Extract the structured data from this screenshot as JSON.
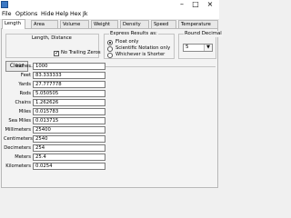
{
  "window": {
    "title": ""
  },
  "menu": [
    "File",
    "Options",
    "Hide",
    "Help",
    "Hex",
    "Jk"
  ],
  "tabs": [
    "Length",
    "Area",
    "Volume",
    "Weight",
    "Density",
    "Speed",
    "Temperature"
  ],
  "active_tab": "Length",
  "header": {
    "unit_type": "Length, Distance",
    "no_trailing_zeros_label": "No Trailing Zeros",
    "no_trailing_zeros_checked": true
  },
  "express_results": {
    "label": "Express Results as:",
    "options": [
      "Float only",
      "Scientific Notation only",
      "Whichever is Shorter"
    ],
    "selected": "Float only"
  },
  "round_decimal": {
    "label": "Round Decimal",
    "value": "5"
  },
  "clear_label": "Clear",
  "units": [
    {
      "label": "Inches",
      "value": "1000"
    },
    {
      "label": "Feet",
      "value": "83.333333"
    },
    {
      "label": "Yards",
      "value": "27.777778"
    },
    {
      "label": "Rods",
      "value": "5.050505"
    },
    {
      "label": "Chains",
      "value": "1.262626"
    },
    {
      "label": "Miles",
      "value": "0.015783"
    },
    {
      "label": "Sea Miles",
      "value": "0.013715"
    },
    {
      "label": "Millimeters",
      "value": "25400"
    },
    {
      "label": "Centimeters",
      "value": "2540"
    },
    {
      "label": "Decimeters",
      "value": "254"
    },
    {
      "label": "Meters",
      "value": "25.4"
    },
    {
      "label": "Kilometers",
      "value": "0.0254"
    }
  ]
}
